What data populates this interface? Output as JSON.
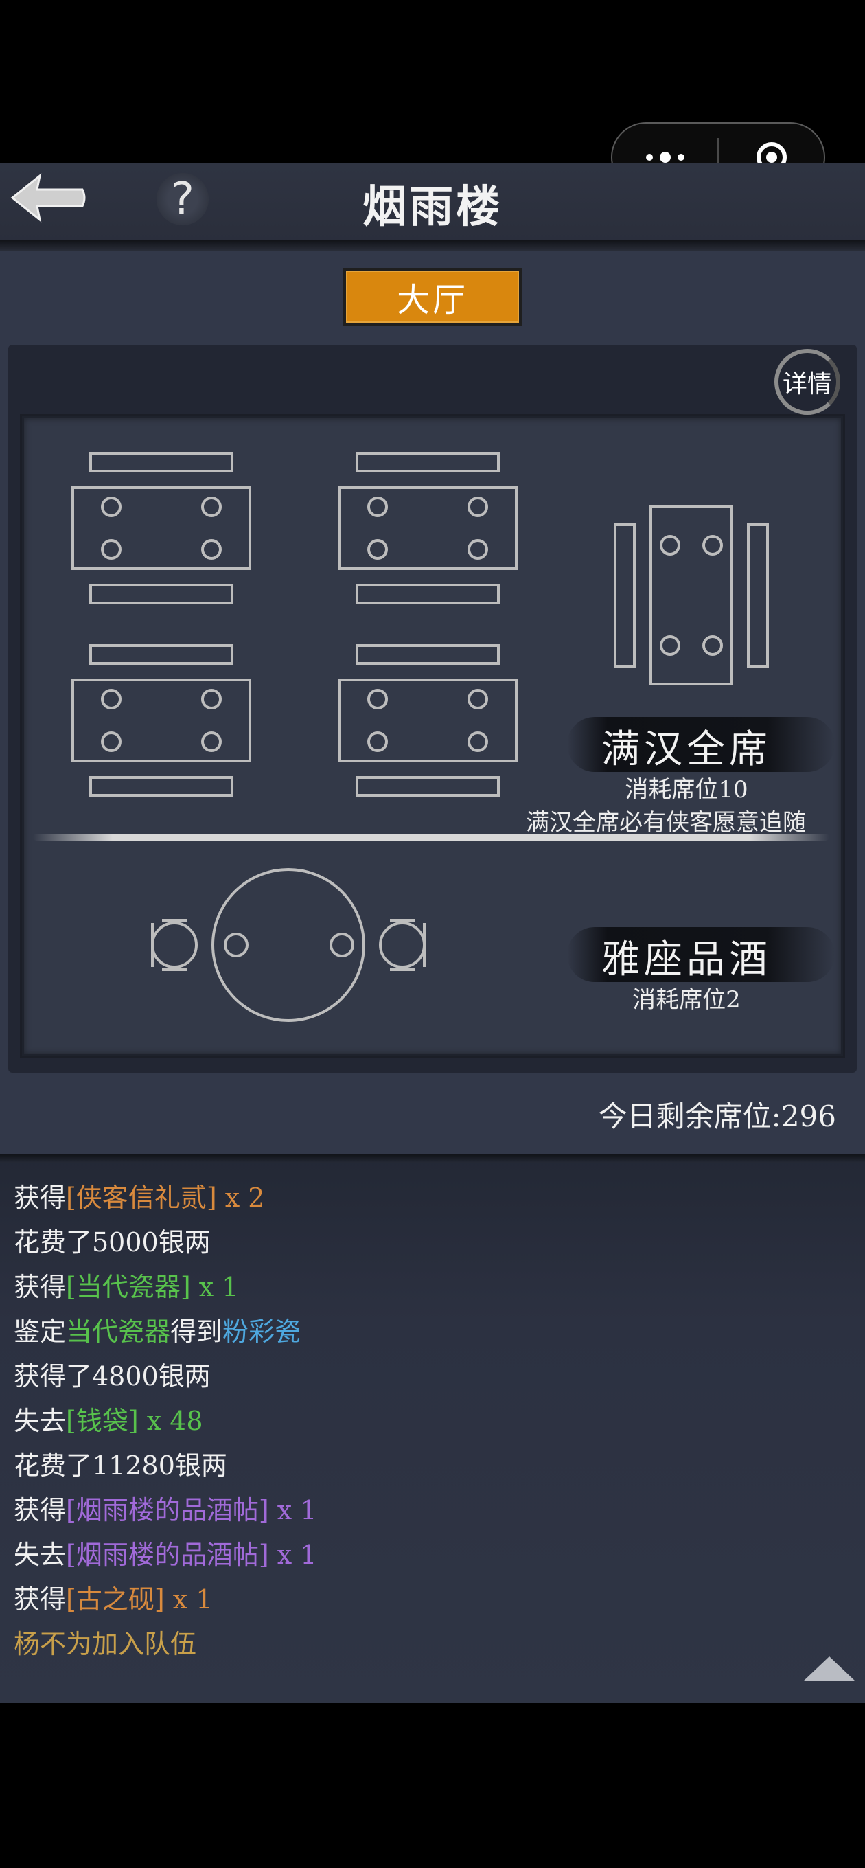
{
  "header": {
    "title": "烟雨楼",
    "help_glyph": "?"
  },
  "capsule": {
    "more_icon": "more-dots-icon",
    "close_icon": "target-icon"
  },
  "hall_tab": "大厅",
  "detail_button": "详情",
  "feasts": [
    {
      "name": "满汉全席",
      "cost": "消耗席位10",
      "note": "满汉全席必有侠客愿意追随"
    },
    {
      "name": "雅座品酒",
      "cost": "消耗席位2"
    }
  ],
  "remaining": {
    "label": "今日剩余席位:",
    "value": "296"
  },
  "log": [
    {
      "parts": [
        {
          "t": "获得",
          "c": "w"
        },
        {
          "t": "[侠客信礼贰] x 2",
          "c": "o"
        }
      ]
    },
    {
      "parts": [
        {
          "t": "花费了5000银两",
          "c": "w"
        }
      ]
    },
    {
      "parts": [
        {
          "t": "获得",
          "c": "w"
        },
        {
          "t": "[当代瓷器] x 1",
          "c": "g"
        }
      ]
    },
    {
      "parts": [
        {
          "t": "鉴定",
          "c": "w"
        },
        {
          "t": "当代瓷器",
          "c": "g"
        },
        {
          "t": "得到",
          "c": "w"
        },
        {
          "t": "粉彩瓷",
          "c": "b"
        }
      ]
    },
    {
      "parts": [
        {
          "t": "获得了4800银两",
          "c": "w"
        }
      ]
    },
    {
      "parts": [
        {
          "t": "失去",
          "c": "w"
        },
        {
          "t": "[钱袋] x 48",
          "c": "g"
        }
      ]
    },
    {
      "parts": [
        {
          "t": "花费了11280银两",
          "c": "w"
        }
      ]
    },
    {
      "parts": [
        {
          "t": "获得",
          "c": "w"
        },
        {
          "t": "[烟雨楼的品酒帖] x 1",
          "c": "p"
        }
      ]
    },
    {
      "parts": [
        {
          "t": "失去",
          "c": "w"
        },
        {
          "t": "[烟雨楼的品酒帖] x 1",
          "c": "p"
        }
      ]
    },
    {
      "parts": [
        {
          "t": "获得",
          "c": "w"
        },
        {
          "t": "[古之砚] x 1",
          "c": "o"
        }
      ]
    },
    {
      "parts": [
        {
          "t": "杨不为加入队伍",
          "c": "gold"
        }
      ]
    }
  ],
  "colors": {
    "accent_tab": "#d9870e",
    "orange_item": "#d98a3d",
    "green_item": "#58c24c",
    "blue_item": "#4ea8df",
    "purple_item": "#a16ad9"
  }
}
